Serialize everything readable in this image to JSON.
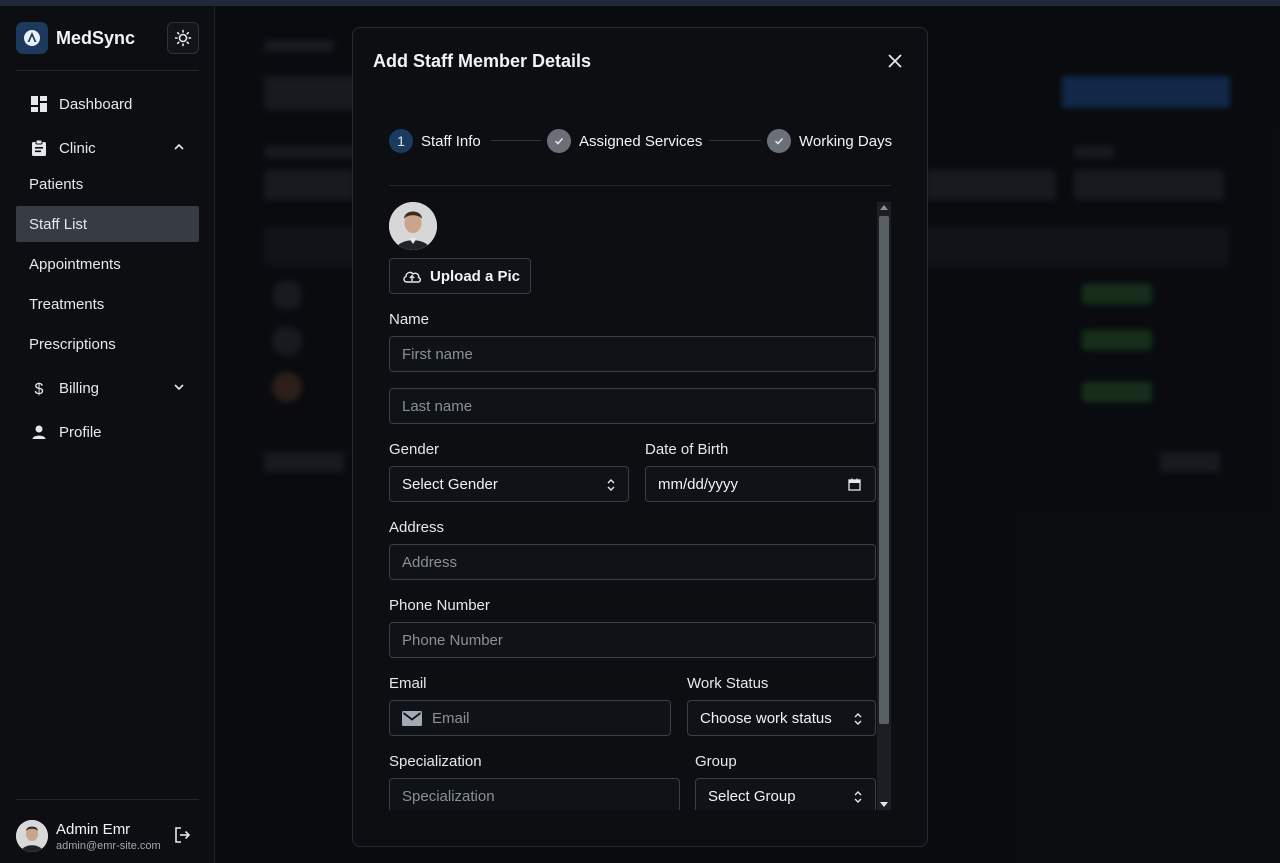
{
  "app": {
    "name": "MedSync"
  },
  "sidebar": {
    "items": [
      {
        "label": "Dashboard",
        "icon": "dashboard-icon"
      },
      {
        "label": "Clinic",
        "icon": "clipboard-icon",
        "expanded": true
      },
      {
        "label": "Billing",
        "icon": "dollar-icon",
        "expanded": false
      },
      {
        "label": "Profile",
        "icon": "person-icon"
      }
    ],
    "clinic_sub": [
      "Patients",
      "Staff List",
      "Appointments",
      "Treatments",
      "Prescriptions"
    ],
    "active": "Staff List"
  },
  "user": {
    "name": "Admin Emr",
    "email": "admin@emr-site.com"
  },
  "modal": {
    "title": "Add Staff Member Details",
    "steps": [
      {
        "number": "1",
        "label": "Staff Info",
        "state": "active"
      },
      {
        "label": "Assigned Services",
        "state": "done"
      },
      {
        "label": "Working Days",
        "state": "done"
      }
    ],
    "upload_label": "Upload a Pic",
    "fields": {
      "name_label": "Name",
      "first_name_placeholder": "First name",
      "last_name_placeholder": "Last name",
      "gender_label": "Gender",
      "gender_value": "Select Gender",
      "dob_label": "Date of Birth",
      "dob_value": "mm/dd/yyyy",
      "address_label": "Address",
      "address_placeholder": "Address",
      "phone_label": "Phone Number",
      "phone_placeholder": "Phone Number",
      "email_label": "Email",
      "email_placeholder": "Email",
      "work_status_label": "Work Status",
      "work_status_value": "Choose work status",
      "specialization_label": "Specialization",
      "specialization_placeholder": "Specialization",
      "group_label": "Group",
      "group_value": "Select Group"
    }
  },
  "colors": {
    "active_nav": "#373c44",
    "step_active": "#1c3a5e",
    "step_done": "#6b7078"
  }
}
